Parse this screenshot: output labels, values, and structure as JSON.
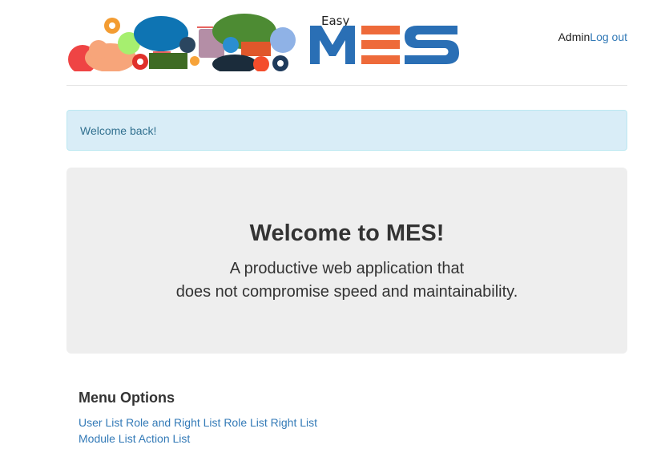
{
  "header": {
    "logo_small_text": "Easy",
    "logo_main_text": "MES",
    "user_name": "Admin",
    "logout_label": "Log out",
    "colors": {
      "logo_blue": "#2a6fb5",
      "logo_orange": "#ee6a3a"
    }
  },
  "alert": {
    "message": "Welcome back!"
  },
  "jumbotron": {
    "title": "Welcome to MES!",
    "subtitle_line1": "A productive web application that",
    "subtitle_line2": "does not compromise speed and maintainability."
  },
  "menu": {
    "title": "Menu Options",
    "links": [
      "User List",
      "Role and Right List",
      "Role List",
      "Right List",
      "Module List",
      "Action List"
    ]
  }
}
